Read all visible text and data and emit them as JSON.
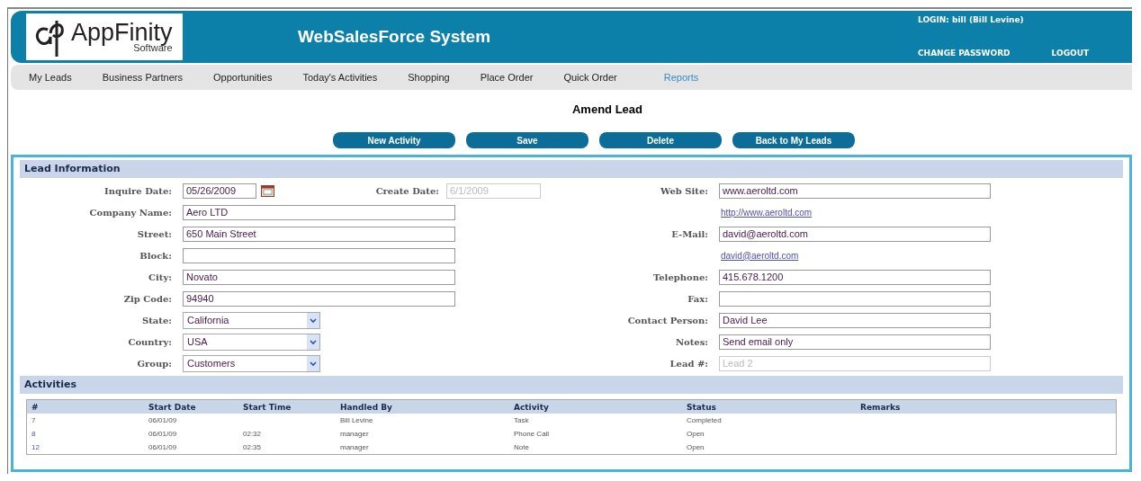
{
  "header": {
    "logo_text": "AppFinity",
    "logo_subtext": "Software",
    "title": "WebSalesForce System",
    "login": "LOGIN: bill (Bill Levine)",
    "links": [
      "CHANGE PASSWORD",
      "LOGOUT"
    ]
  },
  "nav": [
    {
      "label": "My Leads",
      "selected": false
    },
    {
      "label": "Business Partners",
      "selected": false
    },
    {
      "label": "Opportunities",
      "selected": false
    },
    {
      "label": "Today's Activities",
      "selected": false
    },
    {
      "label": "Shopping",
      "selected": false
    },
    {
      "label": "Place Order",
      "selected": false
    },
    {
      "label": "Quick Order",
      "selected": false
    },
    {
      "label": "Reports",
      "selected": true
    }
  ],
  "page_title": "Amend Lead",
  "buttons": [
    "New Activity",
    "Save",
    "Delete",
    "Back to My Leads"
  ],
  "lead_information": {
    "title": "Lead Information",
    "left_fields": [
      {
        "kind": "date",
        "label": "Inquire Date:",
        "value": "05/26/2009",
        "extra_label": "Create Date:",
        "extra_value": "6/1/2009",
        "extra_disabled": true
      },
      {
        "kind": "text",
        "label": "Company Name:",
        "value": "Aero LTD"
      },
      {
        "kind": "text",
        "label": "Street:",
        "value": "650 Main Street"
      },
      {
        "kind": "text",
        "label": "Block:"
      },
      {
        "kind": "text",
        "label": "City:",
        "value": "Novato"
      },
      {
        "kind": "text",
        "label": "Zip Code:",
        "value": "94940"
      },
      {
        "kind": "select",
        "label": "State:",
        "value": "California"
      },
      {
        "kind": "select",
        "label": "Country:",
        "value": "USA"
      },
      {
        "kind": "select",
        "label": "Group:",
        "value": "Customers"
      }
    ],
    "right_fields": [
      {
        "kind": "text",
        "label": "Web Site:",
        "value": "www.aeroltd.com",
        "disabled": false
      },
      {
        "kind": "link",
        "value": "http://www.aeroltd.com"
      },
      {
        "kind": "text",
        "label": "E-Mail:",
        "value": "david@aeroltd.com",
        "disabled": false
      },
      {
        "kind": "link",
        "value": "david@aeroltd.com"
      },
      {
        "kind": "text",
        "label": "Telephone:",
        "value": "415.678.1200",
        "disabled": false
      },
      {
        "kind": "text",
        "label": "Fax:",
        "disabled": false
      },
      {
        "kind": "text",
        "label": "Contact Person:",
        "value": "David Lee",
        "disabled": false
      },
      {
        "kind": "text",
        "label": "Notes:",
        "value": "Send email only",
        "disabled": false
      },
      {
        "kind": "text",
        "label": "Lead #:",
        "value": "Lead 2",
        "disabled": true
      }
    ]
  },
  "activities": {
    "title": "Activities",
    "columns": [
      "#",
      "Start Date",
      "Start Time",
      "Handled By",
      "Activity",
      "Status",
      "Remarks"
    ],
    "rows": [
      [
        "7",
        "06/01/09",
        "",
        "Bill Levine",
        "Task",
        "Completed",
        ""
      ],
      [
        "8",
        "06/01/09",
        "02:32",
        "manager",
        "Phone Call",
        "Open",
        ""
      ],
      [
        "12",
        "06/01/09",
        "02:35",
        "manager",
        "Note",
        "Open",
        ""
      ]
    ]
  }
}
